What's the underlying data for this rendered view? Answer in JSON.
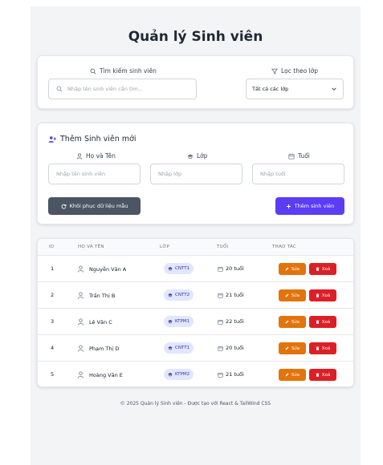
{
  "page": {
    "title": "Quản lý Sinh viên"
  },
  "search": {
    "label": "Tìm kiếm sinh viên",
    "placeholder": "Nhập tên sinh viên cần tìm...",
    "filter_label": "Lọc theo lớp",
    "filter_value": "Tất cả các lớp"
  },
  "form": {
    "title": "Thêm Sinh viên mới",
    "name_label": "Họ và Tên",
    "name_placeholder": "Nhập tên sinh viên",
    "class_label": "Lớp",
    "class_placeholder": "Nhập lớp",
    "age_label": "Tuổi",
    "age_placeholder": "Nhập tuổi",
    "restore_label": "Khôi phục dữ liệu mẫu",
    "add_label": "Thêm sinh viên"
  },
  "table": {
    "headers": [
      "ID",
      "HỌ VÀ TÊN",
      "LỚP",
      "TUỔI",
      "THAO TÁC"
    ],
    "edit_label": "Sửa",
    "delete_label": "Xoá",
    "rows": [
      {
        "id": "1",
        "name": "Nguyễn Văn A",
        "class": "CNTT1",
        "age": "20 tuổi"
      },
      {
        "id": "2",
        "name": "Trần Thị B",
        "class": "CNTT2",
        "age": "21 tuổi"
      },
      {
        "id": "3",
        "name": "Lê Văn C",
        "class": "KTPM1",
        "age": "22 tuổi"
      },
      {
        "id": "4",
        "name": "Phạm Thị D",
        "class": "CNTT1",
        "age": "20 tuổi"
      },
      {
        "id": "5",
        "name": "Hoàng Văn E",
        "class": "KTPM2",
        "age": "21 tuổi"
      }
    ]
  },
  "footer": {
    "text": "© 2025 Quản lý Sinh viên - Được tạo với React & TailWind CSS"
  },
  "colors": {
    "primary": "#5b3df5",
    "restore": "#4b5563",
    "edit": "#e2740c",
    "delete": "#dc1f26",
    "badge_bg": "#e0e7ff",
    "badge_text": "#3730a3",
    "background": "#f3f4f6"
  },
  "icons": {
    "search": "search-icon",
    "filter": "filter-icon",
    "add_user": "user-plus-icon",
    "user": "user-icon",
    "class": "graduation-cap-icon",
    "age": "calendar-icon",
    "restore": "refresh-icon",
    "add": "plus-icon",
    "edit": "pencil-icon",
    "delete": "trash-icon"
  }
}
